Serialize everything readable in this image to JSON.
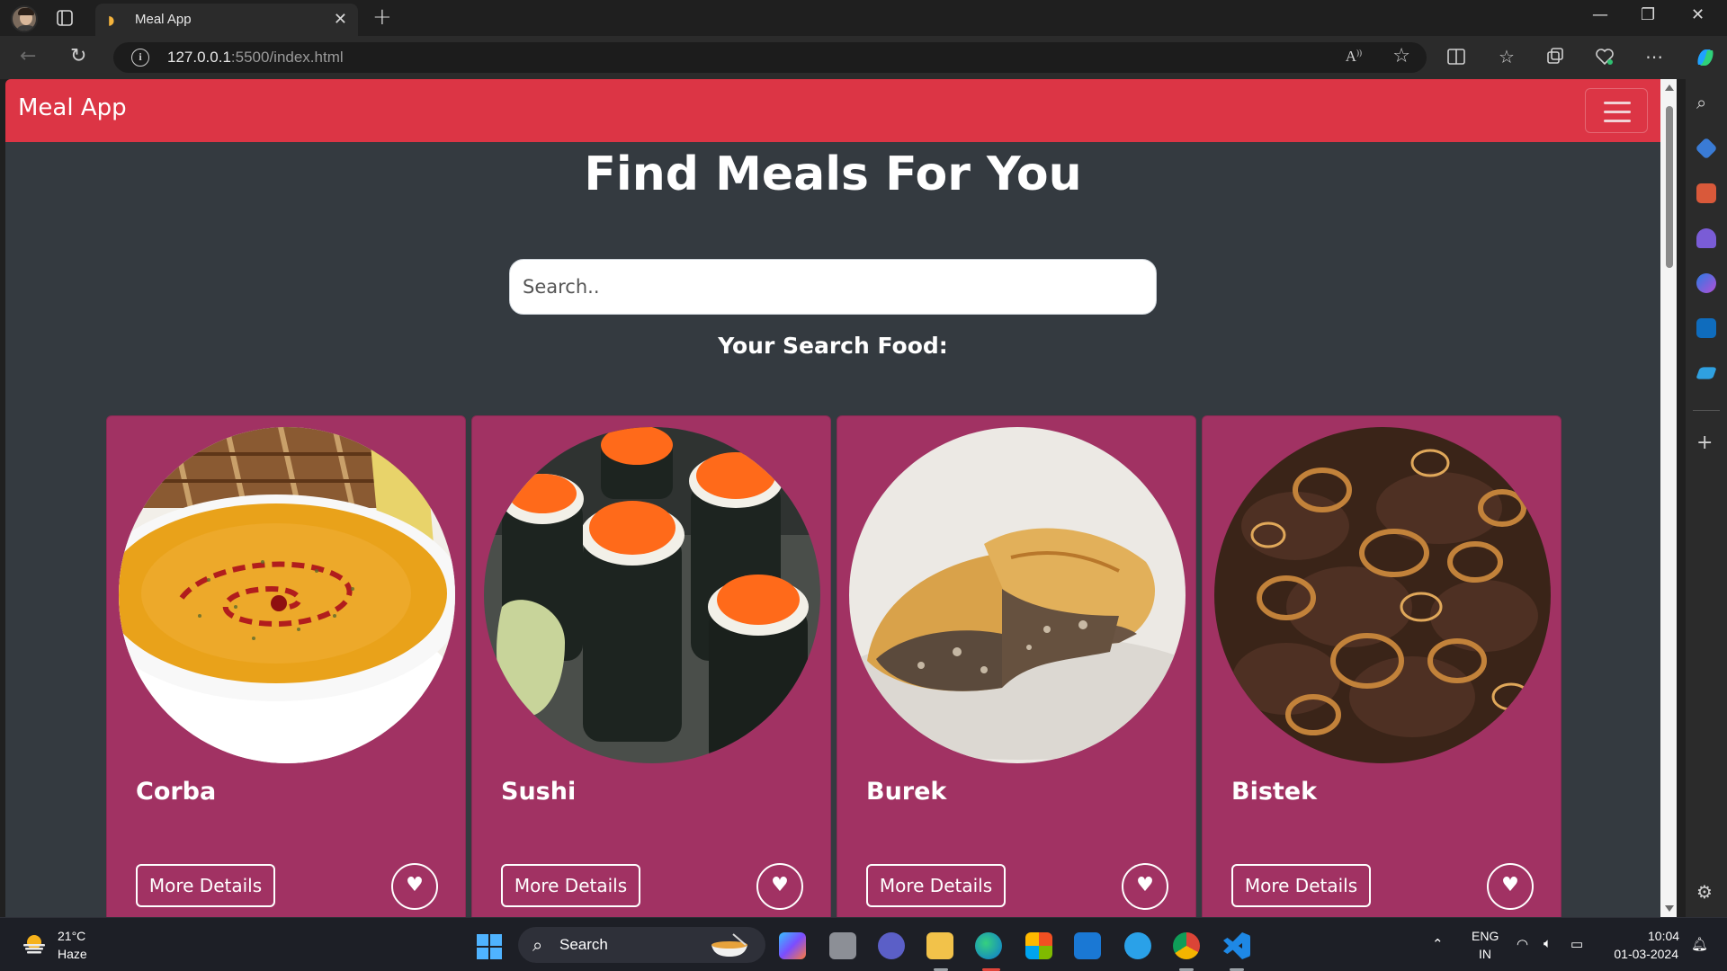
{
  "browser": {
    "tab_title": "Meal App",
    "url_host": "127.0.0.1",
    "url_rest": ":5500/index.html",
    "read_aloud_label": "A"
  },
  "page": {
    "brand": "Meal App",
    "title": "Find Meals For You",
    "search_placeholder": "Search..",
    "subtitle": "Your Search Food:",
    "details_label": "More Details",
    "accent_color": "#dc3545",
    "card_color": "#a13263",
    "background_color": "#343a40",
    "meals": [
      {
        "name": "Corba",
        "image": "soup-bowl"
      },
      {
        "name": "Sushi",
        "image": "sushi-rolls"
      },
      {
        "name": "Burek",
        "image": "meat-pastry"
      },
      {
        "name": "Bistek",
        "image": "beef-with-onions"
      }
    ]
  },
  "taskbar": {
    "temperature": "21°C",
    "condition": "Haze",
    "search_label": "Search",
    "language_top": "ENG",
    "language_bottom": "IN",
    "time": "10:04",
    "date": "01-03-2024"
  }
}
